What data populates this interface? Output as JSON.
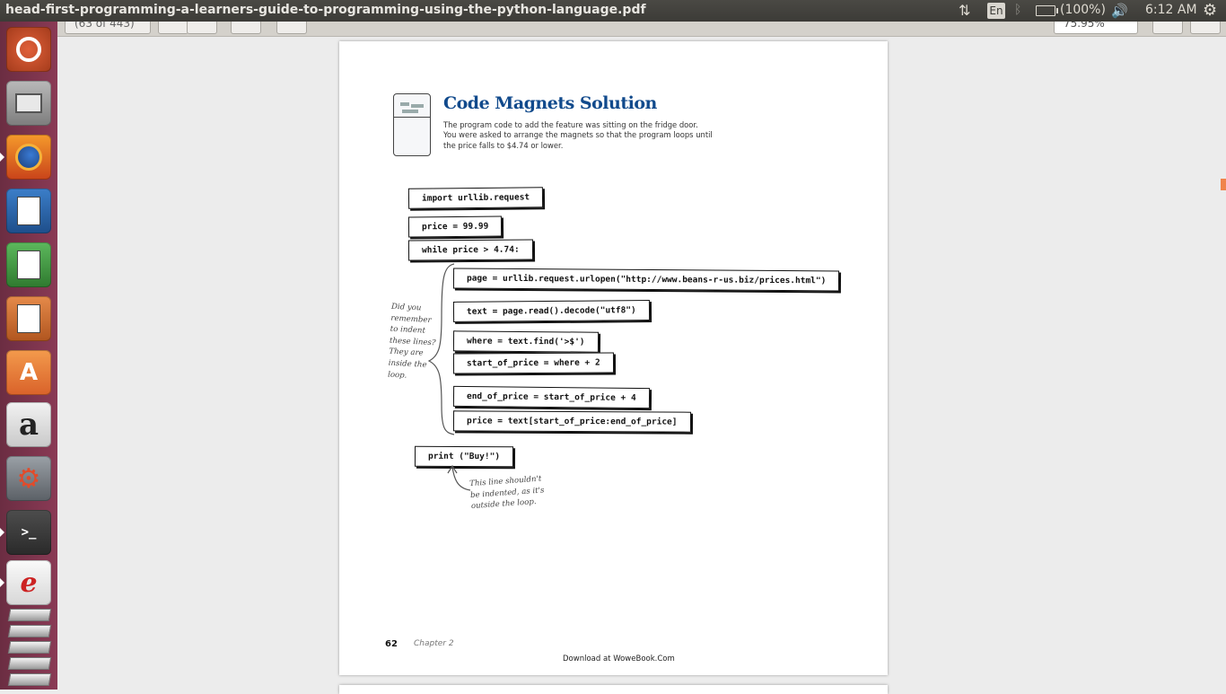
{
  "window": {
    "title": "head-first-programming-a-learners-guide-to-programming-using-the-python-language.pdf"
  },
  "tray": {
    "keyboard": "En",
    "battery": "(100%)",
    "clock": "6:12 AM"
  },
  "toolbar": {
    "pages_value": "(63 of 443)",
    "zoom_value": "75.95%"
  },
  "launcher": {
    "items": [
      "Ubuntu",
      "Files",
      "Firefox",
      "LibreOffice Writer",
      "LibreOffice Calc",
      "LibreOffice Impress",
      "Ubuntu Software",
      "Amazon",
      "System Settings",
      "Terminal",
      "Document Viewer",
      "Workspaces"
    ]
  },
  "document": {
    "heading": "Code Magnets Solution",
    "description": "The program code to add the feature was sitting on the fridge door. You were asked to arrange the magnets so that the program loops until the price falls to $4.74 or lower.",
    "magnets": [
      "import urllib.request",
      "price = 99.99",
      "while price > 4.74:",
      "page = urllib.request.urlopen(\"http://www.beans-r-us.biz/prices.html\")",
      "text = page.read().decode(\"utf8\")",
      "where = text.find('>$')",
      "start_of_price = where + 2",
      "end_of_price = start_of_price + 4",
      "price = text[start_of_price:end_of_price]",
      "print (\"Buy!\")"
    ],
    "indent_note": "Did you remember to indent these lines? They are inside the loop.",
    "print_note": "This line shouldn't be indented, as it's outside the loop.",
    "page_number": "62",
    "chapter": "Chapter 2",
    "footer": "Download at WoweBook.Com"
  }
}
